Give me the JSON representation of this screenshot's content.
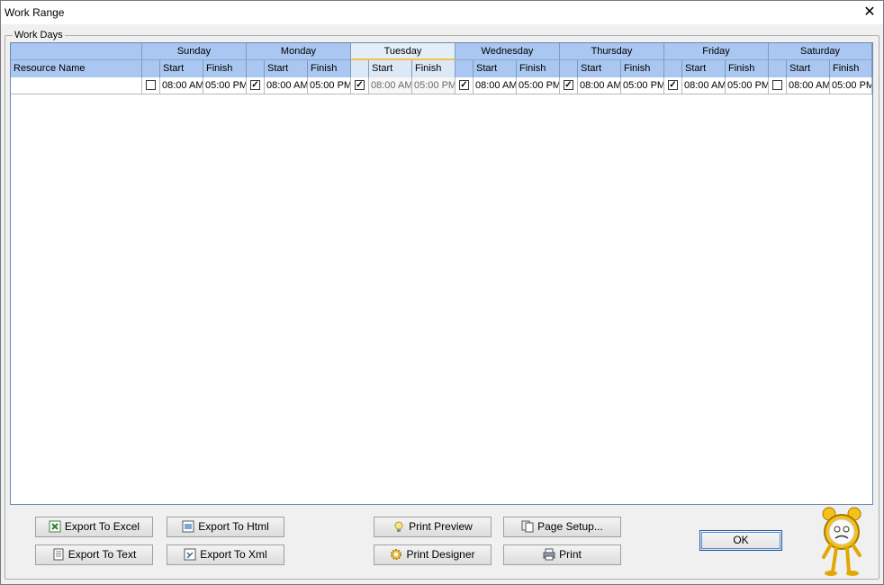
{
  "window": {
    "title": "Work Range",
    "close_glyph": "✕"
  },
  "group": {
    "label": "Work Days"
  },
  "grid": {
    "resource_header": "Resource Name",
    "start_label": "Start",
    "finish_label": "Finish",
    "days": [
      {
        "name": "Sunday",
        "checked": false,
        "start": "08:00 AM",
        "finish": "05:00 PM"
      },
      {
        "name": "Monday",
        "checked": true,
        "start": "08:00 AM",
        "finish": "05:00 PM"
      },
      {
        "name": "Tuesday",
        "checked": true,
        "start": "08:00 AM",
        "finish": "05:00 PM",
        "active": true
      },
      {
        "name": "Wednesday",
        "checked": true,
        "start": "08:00 AM",
        "finish": "05:00 PM"
      },
      {
        "name": "Thursday",
        "checked": true,
        "start": "08:00 AM",
        "finish": "05:00 PM"
      },
      {
        "name": "Friday",
        "checked": true,
        "start": "08:00 AM",
        "finish": "05:00 PM"
      },
      {
        "name": "Saturday",
        "checked": false,
        "start": "08:00 AM",
        "finish": "05:00 PM"
      }
    ],
    "row": {
      "resource_name": ""
    }
  },
  "buttons": {
    "export_excel": "Export To Excel",
    "export_html": "Export To Html",
    "export_text": "Export To Text",
    "export_xml": "Export To Xml",
    "print_preview": "Print Preview",
    "page_setup": "Page Setup...",
    "print_designer": "Print Designer",
    "print": "Print",
    "ok": "OK"
  },
  "colors": {
    "header_blue": "#a9c7f0",
    "active_header": "#e4eef9",
    "accent_underline": "#f5c14b",
    "ok_border": "#1e5aa8"
  },
  "icons": {
    "export_excel": "excel-icon",
    "export_html": "html-icon",
    "export_text": "text-file-icon",
    "export_xml": "xml-icon",
    "print_preview": "lightbulb-icon",
    "page_setup": "pages-icon",
    "print_designer": "gear-icon",
    "print": "printer-icon",
    "mascot": "alarm-clock-mascot-icon"
  }
}
